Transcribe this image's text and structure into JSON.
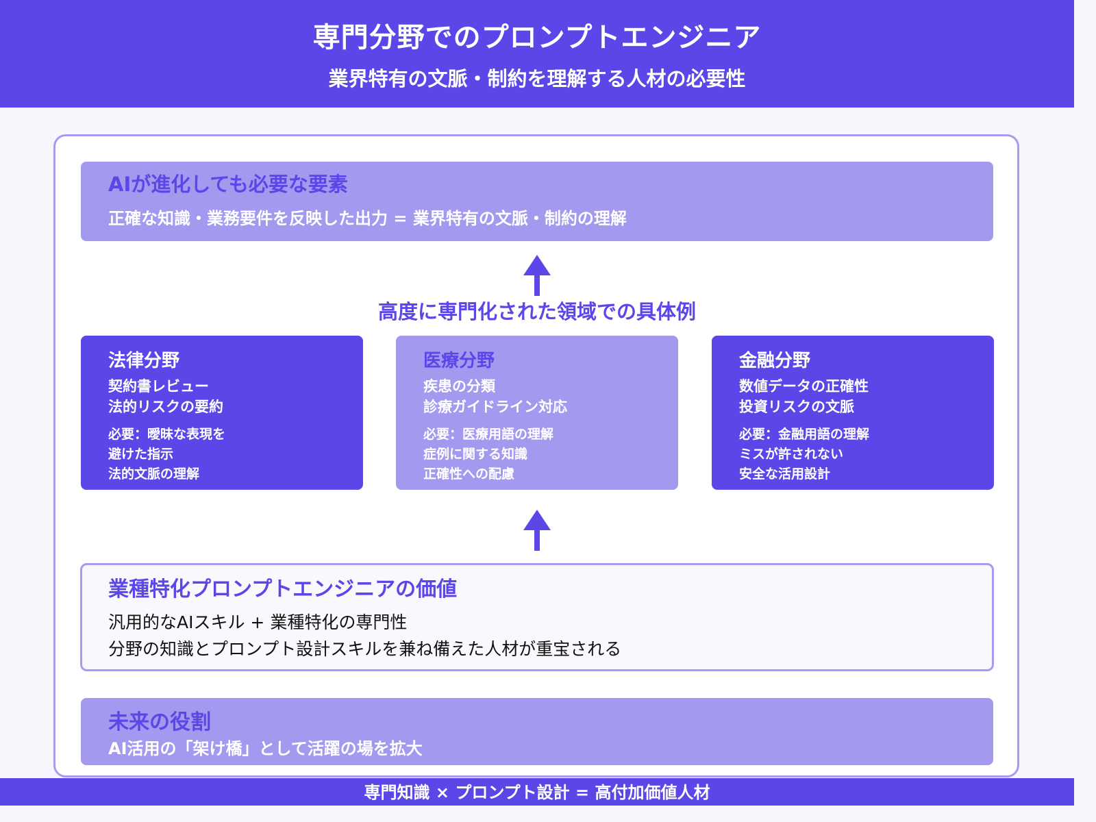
{
  "header": {
    "title": "専門分野でのプロンプトエンジニア",
    "subtitle": "業界特有の文脈・制約を理解する人材の必要性"
  },
  "top_box": {
    "heading": "AIが進化しても必要な要素",
    "text": "正確な知識・業務要件を反映した出力 = 業界特有の文脈・制約の理解"
  },
  "middle_title": "高度に専門化された領域での具体例",
  "cards": [
    {
      "title": "法律分野",
      "lines": [
        "契約書レビュー",
        "法的リスクの要約"
      ],
      "needs": [
        "必要：曖昧な表現を",
        "避けた指示",
        "法的文脈の理解"
      ]
    },
    {
      "title": "医療分野",
      "lines": [
        "疾患の分類",
        "診療ガイドライン対応"
      ],
      "needs": [
        "必要：医療用語の理解",
        "症例に関する知識",
        "正確性への配慮"
      ]
    },
    {
      "title": "金融分野",
      "lines": [
        "数値データの正確性",
        "投資リスクの文脈"
      ],
      "needs": [
        "必要：金融用語の理解",
        "ミスが許されない",
        "安全な活用設計"
      ]
    }
  ],
  "value_box": {
    "heading": "業種特化プロンプトエンジニアの価値",
    "lines": [
      "汎用的なAIスキル + 業種特化の専門性",
      "分野の知識とプロンプト設計スキルを兼ね備えた人材が重宝される"
    ]
  },
  "future_box": {
    "heading": "未来の役割",
    "text": "AI活用の「架け橋」として活躍の場を拡大"
  },
  "footer": "専門知識 × プロンプト設計 = 高付加価値人材",
  "colors": {
    "primary": "#5b46e8",
    "light": "#a399ee",
    "border": "#a59bf0",
    "background": "#f7f6fd"
  }
}
